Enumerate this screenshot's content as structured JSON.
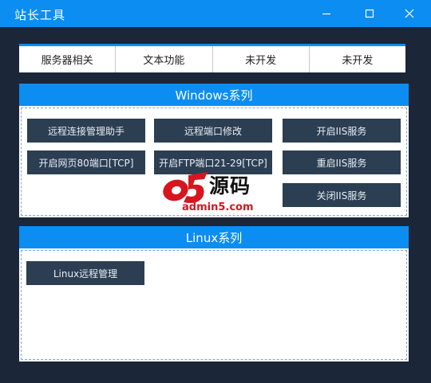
{
  "window": {
    "title": "站长工具"
  },
  "tabs": [
    {
      "label": "服务器相关",
      "active": true
    },
    {
      "label": "文本功能",
      "active": false
    },
    {
      "label": "未开发",
      "active": false
    },
    {
      "label": "未开发",
      "active": false
    }
  ],
  "windows_group": {
    "title": "Windows系列",
    "buttons": [
      "远程连接管理助手",
      "远程端口修改",
      "开启IIS服务",
      "开启网页80端口[TCP]",
      "开启FTP端口21-29[TCP]",
      "重启IIS服务",
      "关闭IIS服务"
    ]
  },
  "linux_group": {
    "title": "Linux系列",
    "buttons": [
      "Linux远程管理"
    ]
  },
  "watermark": {
    "brand": "源码",
    "url": "admin5.com"
  },
  "colors": {
    "accent": "#0b8df2",
    "background": "#1b2638",
    "button": "#2c3e52"
  }
}
